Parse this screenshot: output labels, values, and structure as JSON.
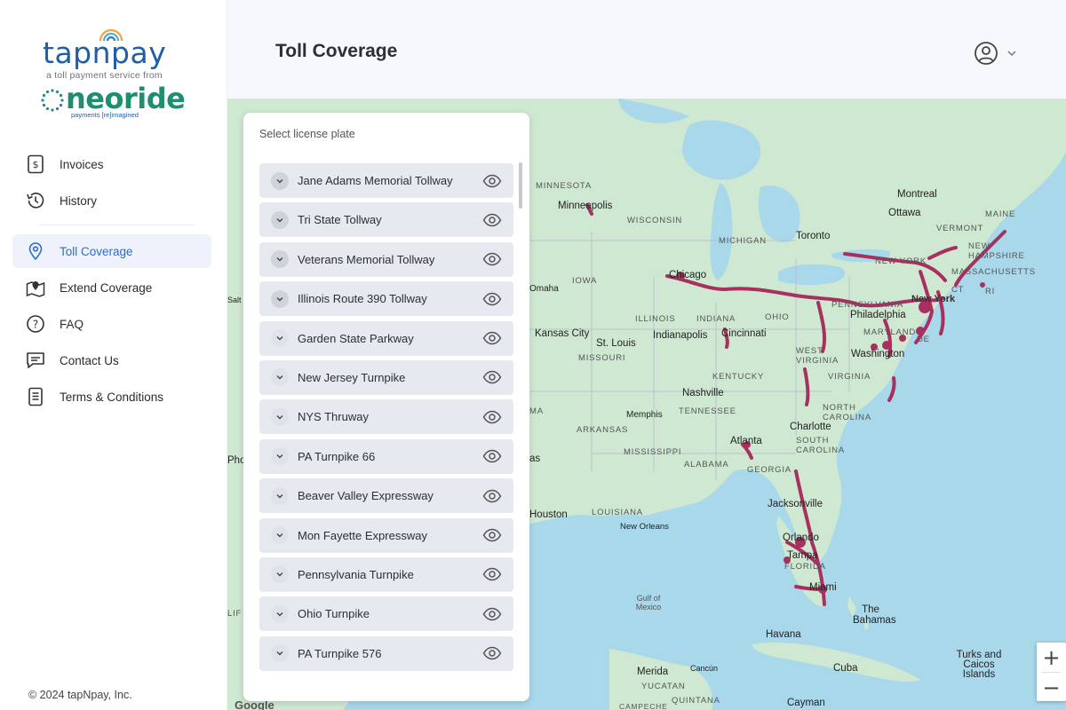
{
  "brand": {
    "logo_main": "tapnpay",
    "tagline": "a toll payment service from",
    "partner_logo": "neoride",
    "partner_tagline": "payments [re]imagined"
  },
  "sidebar": {
    "items": [
      {
        "label": "Invoices",
        "icon": "invoice-icon",
        "active": false
      },
      {
        "label": "History",
        "icon": "history-icon",
        "active": false
      },
      {
        "label": "Toll Coverage",
        "icon": "location-pin-icon",
        "active": true
      },
      {
        "label": "Extend Coverage",
        "icon": "map-pin-icon",
        "active": false
      },
      {
        "label": "FAQ",
        "icon": "help-icon",
        "active": false
      },
      {
        "label": "Contact Us",
        "icon": "chat-icon",
        "active": false
      },
      {
        "label": "Terms & Conditions",
        "icon": "document-icon",
        "active": false
      }
    ],
    "footer": "© 2024 tapNpay, Inc."
  },
  "header": {
    "title": "Toll Coverage"
  },
  "panel": {
    "title": "Select license plate",
    "tollways": [
      {
        "label": "Jane Adams Memorial Tollway"
      },
      {
        "label": "Tri State Tollway"
      },
      {
        "label": "Veterans Memorial Tollway"
      },
      {
        "label": "Illinois Route 390 Tollway"
      },
      {
        "label": "Garden State Parkway"
      },
      {
        "label": "New Jersey Turnpike"
      },
      {
        "label": "NYS Thruway"
      },
      {
        "label": "PA Turnpike 66"
      },
      {
        "label": "Beaver Valley Expressway"
      },
      {
        "label": "Mon Fayette Expressway"
      },
      {
        "label": "Pennsylvania Turnpike"
      },
      {
        "label": "Ohio Turnpike"
      },
      {
        "label": "PA Turnpike 576"
      }
    ]
  },
  "map": {
    "labels": {
      "minnesota": "MINNESOTA",
      "minneapolis": "Minneapolis",
      "wisconsin": "WISCONSIN",
      "michigan": "MICHIGAN",
      "toronto": "Toronto",
      "montreal": "Montreal",
      "ottawa": "Ottawa",
      "maine": "MAINE",
      "vermont": "VERMONT",
      "new_hampshire": "NEW HAMPSHIRE",
      "massachusetts": "MASSACHUSETTS",
      "new_york_state": "NEW YORK",
      "ct": "CT",
      "ri": "RI",
      "chicago": "Chicago",
      "omaha": "Omaha",
      "iowa": "IOWA",
      "pennsylvania": "PENNSYLVANIA",
      "new_york": "New York",
      "philadelphia": "Philadelphia",
      "illinois": "ILLINOIS",
      "indiana": "INDIANA",
      "ohio": "OHIO",
      "kansas_city": "Kansas City",
      "st_louis": "St. Louis",
      "indianapolis": "Indianapolis",
      "cincinnati": "Cincinnati",
      "maryland": "MARYLAND",
      "de": "DE",
      "missouri": "MISSOURI",
      "west_virginia": "WEST VIRGINIA",
      "washington": "Washington",
      "virginia": "VIRGINIA",
      "kentucky": "KENTUCKY",
      "nashville": "Nashville",
      "tennessee": "TENNESSEE",
      "memphis": "Memphis",
      "north_carolina": "NORTH CAROLINA",
      "charlotte": "Charlotte",
      "arkansas": "ARKANSAS",
      "atlanta": "Atlanta",
      "south_carolina": "SOUTH CAROLINA",
      "mississippi": "MISSISSIPPI",
      "alabama": "ALABAMA",
      "georgia": "GEORGIA",
      "houston": "Houston",
      "louisiana": "LOUISIANA",
      "new_orleans": "New Orleans",
      "jacksonville": "Jacksonville",
      "orlando": "Orlando",
      "tampa": "Tampa",
      "florida": "FLORIDA",
      "miami": "Miami",
      "gulf": "Gulf of Mexico",
      "the_bahamas": "The Bahamas",
      "havana": "Havana",
      "cuba": "Cuba",
      "turks": "Turks and Caicos Islands",
      "merida": "Merida",
      "cancun": "Cancún",
      "yucatan": "YUCATAN",
      "quintana": "QUINTANA",
      "cayman": "Cayman",
      "campeche": "CAMPECHE",
      "google": "Google",
      "ma": "MA",
      "as": "as",
      "pho": "Pho",
      "salt": "Salt",
      "lif": "LIF"
    },
    "zoom_in": "+",
    "zoom_out": "−",
    "colors": {
      "water": "#a8d8ea",
      "land": "#cfe8d2",
      "toll_route": "#a8305f"
    }
  }
}
